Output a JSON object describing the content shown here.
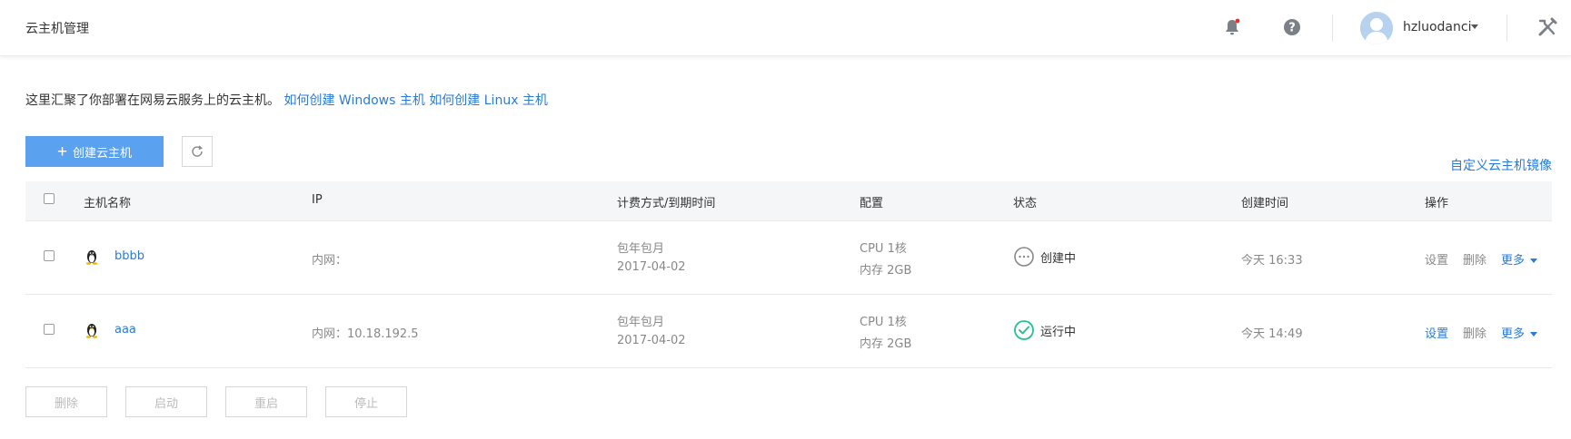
{
  "header": {
    "title": "云主机管理",
    "username": "hzluodanci"
  },
  "intro": {
    "text": "这里汇聚了你部署在网易云服务上的云主机。",
    "link_windows": "如何创建 Windows 主机",
    "link_linux": "如何创建 Linux 主机"
  },
  "toolbar": {
    "create_label": "创建云主机",
    "custom_image_link": "自定义云主机镜像"
  },
  "table": {
    "columns": [
      "主机名称",
      "IP",
      "计费方式/到期时间",
      "配置",
      "状态",
      "创建时间",
      "操作"
    ],
    "rows": [
      {
        "name": "bbbb",
        "ip": "内网：",
        "billing": "包年包月",
        "expiry": "2017-04-02",
        "cpu": "CPU 1核",
        "mem": "内存 2GB",
        "status": "创建中",
        "status_icon": "pending-icon",
        "created": "今天 16:33",
        "actions": {
          "settings": "设置",
          "delete": "删除",
          "more": "更多"
        }
      },
      {
        "name": "aaa",
        "ip": "内网：10.18.192.5",
        "billing": "包年包月",
        "expiry": "2017-04-02",
        "cpu": "CPU 1核",
        "mem": "内存 2GB",
        "status": "运行中",
        "status_icon": "running-check-icon",
        "created": "今天 14:49",
        "actions": {
          "settings": "设置",
          "delete": "删除",
          "more": "更多"
        }
      }
    ]
  },
  "bulk_actions": {
    "delete": "删除",
    "start": "启动",
    "restart": "重启",
    "stop": "停止"
  },
  "colors": {
    "accent": "#5aa2ef",
    "link": "#2a7ad9",
    "running": "#27c28e",
    "notification_dot": "#e5322d"
  }
}
